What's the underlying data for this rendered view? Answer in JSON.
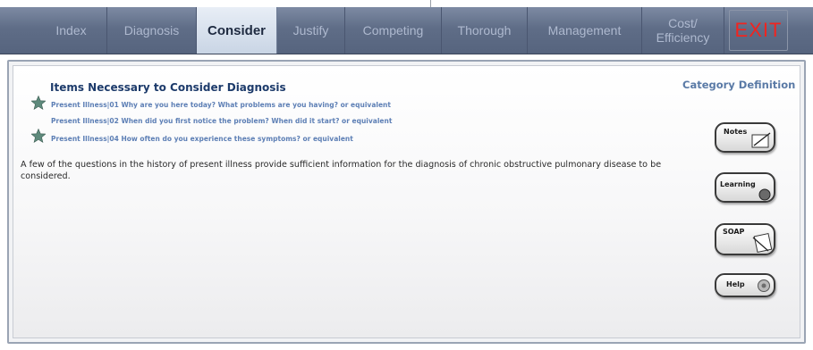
{
  "nav": {
    "tabs": [
      {
        "label": "Index"
      },
      {
        "label": "Diagnosis"
      },
      {
        "label": "Consider"
      },
      {
        "label": "Justify"
      },
      {
        "label": "Competing"
      },
      {
        "label": "Thorough"
      },
      {
        "label": "Management"
      },
      {
        "label": "Cost/\nEfficiency"
      }
    ],
    "exit_label": "EXIT",
    "active_tab": "Consider"
  },
  "main": {
    "heading": "Items Necessary to Consider Diagnosis",
    "category_definition": "Category Definition",
    "items": [
      {
        "text": "Present Illness|01 Why are you here today? What problems are you having? or equivalent",
        "starred": true
      },
      {
        "text": "Present Illness|02 When did you first notice the problem? When did it start? or equivalent",
        "starred": false
      },
      {
        "text": "Present Illness|04 How often do you experience these symptoms? or equivalent",
        "starred": true
      }
    ],
    "description": "A few of the questions in the history of present illness provide sufficient information for the diagnosis of chronic obstructive pulmonary disease to be considered."
  },
  "side_buttons": {
    "notes": "Notes",
    "learning": "Learning",
    "soap": "SOAP",
    "help": "Help"
  },
  "colors": {
    "nav_bg": "#5f6d87",
    "nav_text": "#aeb9cf",
    "active_tab_bg": "#d8e2ee",
    "exit": "#f2241f",
    "heading": "#1d3b6b",
    "item_link": "#5d7fb5",
    "star": "#5e8a7c"
  }
}
